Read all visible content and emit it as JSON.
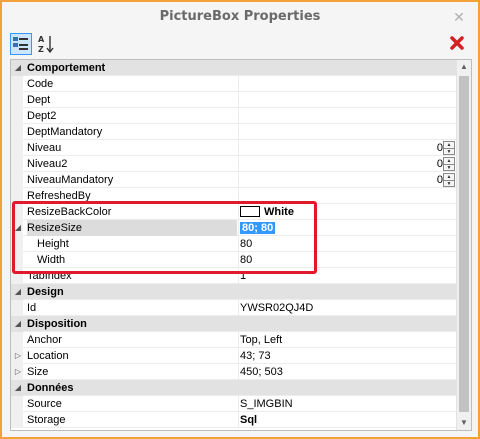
{
  "window": {
    "title": "PictureBox Properties",
    "close_icon": "close-icon"
  },
  "toolbar": {
    "categorized_icon": "categorized-icon",
    "alphabetical_icon": "sort-az-icon",
    "delete_icon": "delete-icon"
  },
  "rows": {
    "c0": {
      "label": "Comportement"
    },
    "r1": {
      "name": "Code",
      "value": ""
    },
    "r2": {
      "name": "Dept",
      "value": ""
    },
    "r3": {
      "name": "Dept2",
      "value": ""
    },
    "r4": {
      "name": "DeptMandatory",
      "value": ""
    },
    "r5": {
      "name": "Niveau",
      "value": "0"
    },
    "r6": {
      "name": "Niveau2",
      "value": "0"
    },
    "r7": {
      "name": "NiveauMandatory",
      "value": "0"
    },
    "r8": {
      "name": "RefreshedBy",
      "value": ""
    },
    "r9": {
      "name": "ResizeBackColor",
      "value": "White"
    },
    "r10": {
      "name": "ResizeSize",
      "value": "80; 80"
    },
    "r11": {
      "name": "Height",
      "value": "80"
    },
    "r12": {
      "name": "Width",
      "value": "80"
    },
    "r13": {
      "name": "TabIndex",
      "value": "1"
    },
    "c1": {
      "label": "Design"
    },
    "r14": {
      "name": "Id",
      "value": "YWSR02QJ4D"
    },
    "c2": {
      "label": "Disposition"
    },
    "r15": {
      "name": "Anchor",
      "value": "Top, Left"
    },
    "r16": {
      "name": "Location",
      "value": "43; 73"
    },
    "r17": {
      "name": "Size",
      "value": "450; 503"
    },
    "c3": {
      "label": "Données"
    },
    "r18": {
      "name": "Source",
      "value": "S_IMGBIN"
    },
    "r19": {
      "name": "Storage",
      "value": "Sql"
    }
  },
  "colors": {
    "accent_border": "#f3a23a",
    "selection": "#3399ff",
    "annotation": "#e1192c"
  }
}
